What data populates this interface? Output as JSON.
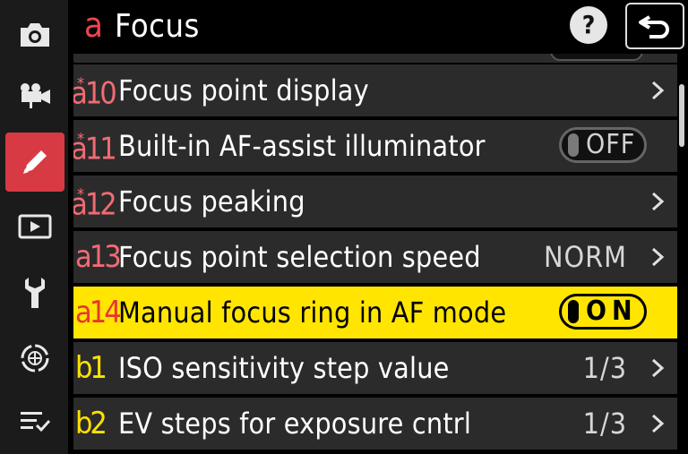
{
  "header": {
    "tab_letter": "a",
    "title": "Focus",
    "help_label": "?"
  },
  "sidebar": {
    "items": [
      {
        "icon": "camera-icon",
        "active": false
      },
      {
        "icon": "movie-camera-icon",
        "active": false
      },
      {
        "icon": "pencil-icon",
        "active": true
      },
      {
        "icon": "playback-icon",
        "active": false
      },
      {
        "icon": "wrench-icon",
        "active": false
      },
      {
        "icon": "network-icon",
        "active": false
      },
      {
        "icon": "my-menu-icon",
        "active": false
      }
    ]
  },
  "menu": {
    "rows": [
      {
        "code": "a10",
        "starred": true,
        "label": "Focus point display",
        "value": "",
        "toggle": "",
        "chevron": true,
        "selected": false,
        "code_color": "pink"
      },
      {
        "code": "a11",
        "starred": true,
        "label": "Built-in AF-assist illuminator",
        "value": "",
        "toggle": "OFF",
        "chevron": false,
        "selected": false,
        "code_color": "pink"
      },
      {
        "code": "a12",
        "starred": true,
        "label": "Focus peaking",
        "value": "",
        "toggle": "",
        "chevron": true,
        "selected": false,
        "code_color": "pink"
      },
      {
        "code": "a13",
        "starred": false,
        "label": "Focus point selection speed",
        "value": "NORM",
        "toggle": "",
        "chevron": true,
        "selected": false,
        "code_color": "pink"
      },
      {
        "code": "a14",
        "starred": false,
        "label": "Manual focus ring in AF mode",
        "value": "",
        "toggle": "ON",
        "chevron": false,
        "selected": true,
        "code_color": "pink"
      },
      {
        "code": "b1",
        "starred": false,
        "label": "ISO sensitivity step value",
        "value": "1/3",
        "toggle": "",
        "chevron": true,
        "selected": false,
        "code_color": "yellow"
      },
      {
        "code": "b2",
        "starred": false,
        "label": "EV steps for exposure cntrl",
        "value": "1/3",
        "toggle": "",
        "chevron": true,
        "selected": false,
        "code_color": "yellow"
      }
    ]
  },
  "colors": {
    "accent_red": "#d83a44",
    "highlight_yellow": "#ffe500",
    "row_bg": "#2b2b2b"
  }
}
